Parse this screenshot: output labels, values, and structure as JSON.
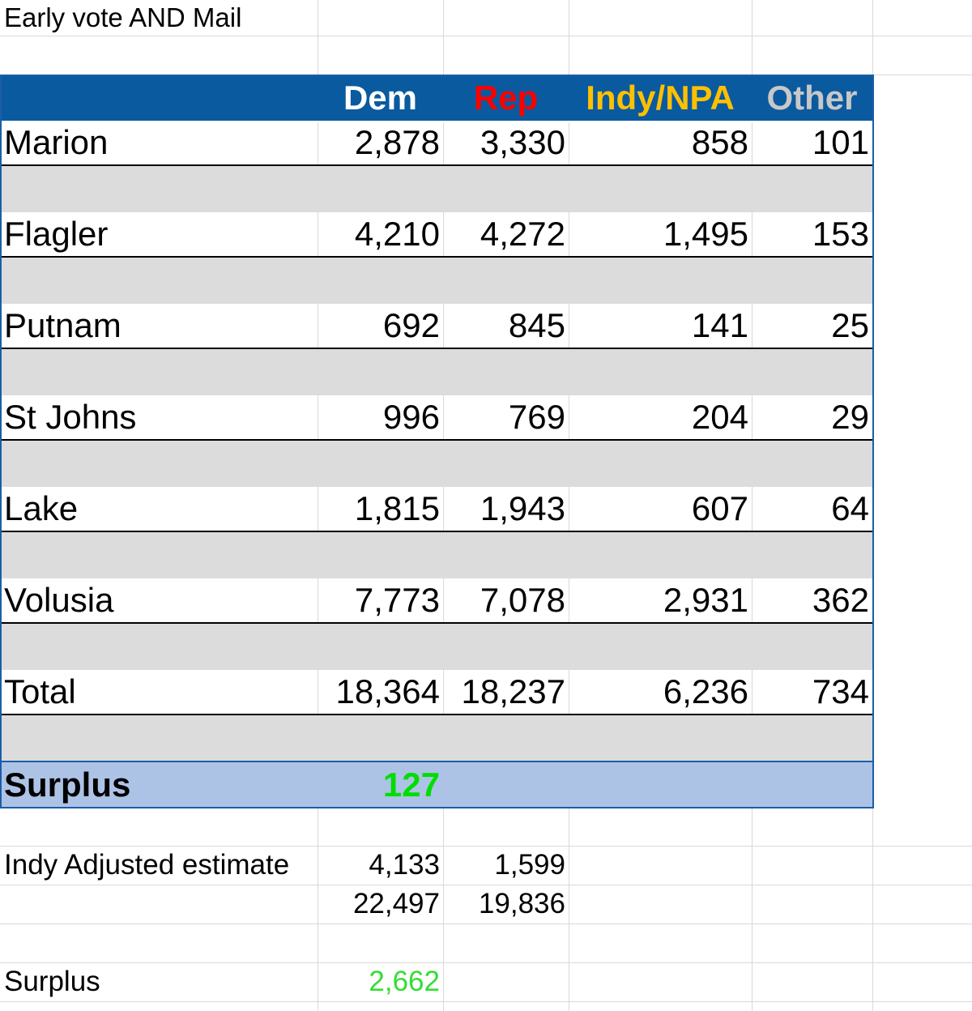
{
  "title": "Early vote AND Mail",
  "header": {
    "dem": "Dem",
    "rep": "Rep",
    "indy": "Indy/NPA",
    "other": "Other"
  },
  "colors": {
    "header_bg": "#0a5aa0",
    "dem": "#ffffff",
    "rep": "#ff0000",
    "indy": "#ffc000",
    "other": "#c8c8c8",
    "surplus_bg": "#adc3e6",
    "surplus_value": "#00dd00"
  },
  "rows": [
    {
      "county": "Marion",
      "dem": "2,878",
      "rep": "3,330",
      "indy": "858",
      "other": "101"
    },
    {
      "county": "Flagler",
      "dem": "4,210",
      "rep": "4,272",
      "indy": "1,495",
      "other": "153"
    },
    {
      "county": "Putnam",
      "dem": "692",
      "rep": "845",
      "indy": "141",
      "other": "25"
    },
    {
      "county": "St Johns",
      "dem": "996",
      "rep": "769",
      "indy": "204",
      "other": "29"
    },
    {
      "county": "Lake",
      "dem": "1,815",
      "rep": "1,943",
      "indy": "607",
      "other": "64"
    },
    {
      "county": "Volusia",
      "dem": "7,773",
      "rep": "7,078",
      "indy": "2,931",
      "other": "362"
    },
    {
      "county": "Total",
      "dem": "18,364",
      "rep": "18,237",
      "indy": "6,236",
      "other": "734"
    }
  ],
  "surplus": {
    "label": "Surplus",
    "value": "127"
  },
  "adjusted": {
    "label": "Indy Adjusted estimate",
    "row1": {
      "dem": "4,133",
      "rep": "1,599"
    },
    "row2": {
      "dem": "22,497",
      "rep": "19,836"
    }
  },
  "surplus2": {
    "label": "Surplus",
    "value": "2,662"
  }
}
